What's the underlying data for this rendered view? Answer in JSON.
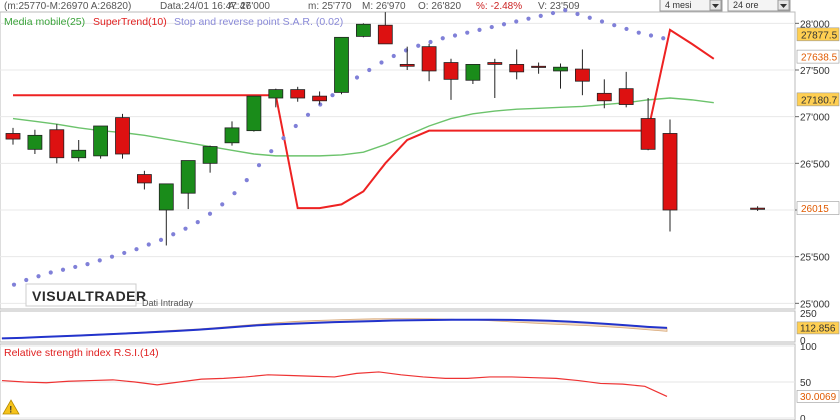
{
  "header": {
    "ohlc_range": "(m:25770-M:26970 A:26820)",
    "date": "Data:24/01 16:47:47",
    "last": "A: 26'000",
    "min": "m: 25'770",
    "max": "M: 26'970",
    "open": "O: 26'820",
    "pct": "%: -2.48%",
    "volume": "V: 23'509",
    "period_select": "4 mesi",
    "timeframe_select": "24 ore"
  },
  "legend": {
    "sma": "Media mobile(25)",
    "supertrend": "SuperTrend(10)",
    "sar": "Stop and reverse point S.A.R. (0.02)",
    "rsi": "Relative strength index R.S.I.(14)"
  },
  "logo": {
    "name": "VISUALTRADER",
    "sub": "Dati Intraday"
  },
  "colors": {
    "up": "#1a8c1a",
    "down": "#dd1111",
    "sma": "#6cc36c",
    "supertrend": "#ee2222",
    "sar": "#8080d8",
    "rsi": "#ee3333",
    "osc": "#2233cc"
  },
  "chart_data": [
    {
      "type": "candlestick",
      "ylim": [
        24950,
        28100
      ],
      "y_ticks": [
        "28'000",
        "27'500",
        "27'000",
        "26'500",
        "26'000",
        "25'500",
        "25'000"
      ],
      "y_tick_values": [
        28000,
        27500,
        27000,
        26500,
        26000,
        25500,
        25000
      ],
      "candles": [
        {
          "o": 26820,
          "h": 26880,
          "l": 26700,
          "c": 26760
        },
        {
          "o": 26650,
          "h": 26860,
          "l": 26600,
          "c": 26800
        },
        {
          "o": 26860,
          "h": 26920,
          "l": 26500,
          "c": 26560
        },
        {
          "o": 26560,
          "h": 26750,
          "l": 26520,
          "c": 26640
        },
        {
          "o": 26580,
          "h": 26900,
          "l": 26550,
          "c": 26900
        },
        {
          "o": 26990,
          "h": 27030,
          "l": 26550,
          "c": 26600
        },
        {
          "o": 26380,
          "h": 26420,
          "l": 26220,
          "c": 26290
        },
        {
          "o": 26000,
          "h": 26270,
          "l": 25620,
          "c": 26280
        },
        {
          "o": 26180,
          "h": 26530,
          "l": 26010,
          "c": 26530
        },
        {
          "o": 26500,
          "h": 26690,
          "l": 26400,
          "c": 26680
        },
        {
          "o": 26720,
          "h": 26950,
          "l": 26690,
          "c": 26880
        },
        {
          "o": 26850,
          "h": 27220,
          "l": 26840,
          "c": 27220
        },
        {
          "o": 27200,
          "h": 27300,
          "l": 27100,
          "c": 27290
        },
        {
          "o": 27290,
          "h": 27320,
          "l": 27160,
          "c": 27200
        },
        {
          "o": 27220,
          "h": 27270,
          "l": 27130,
          "c": 27170
        },
        {
          "o": 27260,
          "h": 27850,
          "l": 27240,
          "c": 27850
        },
        {
          "o": 27860,
          "h": 28000,
          "l": 27850,
          "c": 27990
        },
        {
          "o": 27980,
          "h": 28120,
          "l": 27780,
          "c": 27780
        },
        {
          "o": 27560,
          "h": 27750,
          "l": 27500,
          "c": 27540
        },
        {
          "o": 27750,
          "h": 27780,
          "l": 27380,
          "c": 27490
        },
        {
          "o": 27580,
          "h": 27620,
          "l": 27180,
          "c": 27400
        },
        {
          "o": 27390,
          "h": 27560,
          "l": 27350,
          "c": 27560
        },
        {
          "o": 27580,
          "h": 27620,
          "l": 27200,
          "c": 27560
        },
        {
          "o": 27560,
          "h": 27720,
          "l": 27400,
          "c": 27480
        },
        {
          "o": 27540,
          "h": 27580,
          "l": 27460,
          "c": 27530
        },
        {
          "o": 27490,
          "h": 27570,
          "l": 27300,
          "c": 27530
        },
        {
          "o": 27510,
          "h": 27720,
          "l": 27230,
          "c": 27380
        },
        {
          "o": 27250,
          "h": 27400,
          "l": 27090,
          "c": 27170
        },
        {
          "o": 27300,
          "h": 27480,
          "l": 27100,
          "c": 27130
        },
        {
          "o": 26980,
          "h": 27200,
          "l": 26640,
          "c": 26650
        },
        {
          "o": 26820,
          "h": 26970,
          "l": 25770,
          "c": 26000
        },
        null,
        null,
        null,
        {
          "o": 26020,
          "h": 26040,
          "l": 25990,
          "c": 26010
        }
      ],
      "sma": [
        26980,
        26950,
        26920,
        26880,
        26850,
        26830,
        26800,
        26760,
        26720,
        26680,
        26640,
        26600,
        26580,
        26580,
        26580,
        26590,
        26620,
        26700,
        26800,
        26900,
        26980,
        27030,
        27060,
        27080,
        27090,
        27100,
        27110,
        27130,
        27150,
        27180,
        27200,
        27180,
        27150
      ],
      "supertrend": [
        27230,
        27230,
        27230,
        27230,
        27230,
        27230,
        27230,
        27230,
        27230,
        27230,
        27230,
        27230,
        27230,
        26020,
        26020,
        26060,
        26200,
        26500,
        26750,
        26850,
        26850,
        26850,
        26850,
        26850,
        26850,
        26850,
        26850,
        26850,
        26850,
        26850,
        27930,
        27780,
        27620
      ],
      "sar": [
        25200,
        25250,
        25290,
        25330,
        25360,
        25390,
        25420,
        25460,
        25500,
        25540,
        25580,
        25630,
        25680,
        25740,
        25800,
        25870,
        25960,
        26060,
        26180,
        26320,
        26480,
        26630,
        26770,
        26900,
        27020,
        27130,
        27230,
        27330,
        27420,
        27500,
        27580,
        27650,
        27710,
        27760,
        27800,
        27840,
        27870,
        27900,
        27930,
        27960,
        27990,
        28020,
        28050,
        28080,
        28110,
        28140,
        28100,
        28060,
        28020,
        27980,
        27940,
        27900,
        27870,
        27840
      ],
      "labels": [
        {
          "value": "27877.5",
          "y": 27877,
          "bg": "#ffcf52"
        },
        {
          "value": "27638.5",
          "y": 27638,
          "bg": "#ffffff"
        },
        {
          "value": "27180.7",
          "y": 27180,
          "bg": "#ffcf52"
        },
        {
          "value": "26015",
          "y": 26015,
          "bg": "#ffffff"
        }
      ]
    },
    {
      "type": "oscillator",
      "ylim": [
        0,
        250
      ],
      "y_ticks": [
        "250",
        "0"
      ],
      "label": "112.856",
      "values": [
        15,
        20,
        28,
        35,
        42,
        50,
        58,
        66,
        75,
        85,
        95,
        108,
        122,
        135,
        145,
        152,
        158,
        165,
        170,
        175,
        180,
        183,
        185,
        187,
        188,
        188,
        186,
        183,
        178,
        170,
        160,
        148,
        135,
        122,
        112
      ],
      "band": [
        18,
        22,
        30,
        38,
        46,
        54,
        62,
        72,
        82,
        92,
        102,
        115,
        130,
        145,
        160,
        172,
        180,
        186,
        192,
        196,
        198,
        198,
        196,
        192,
        186,
        178,
        168,
        158,
        148,
        140,
        132,
        122,
        110,
        95,
        80
      ]
    },
    {
      "type": "line",
      "name": "R.S.I.",
      "ylim": [
        0,
        100
      ],
      "y_ticks": [
        "100",
        "50",
        "0"
      ],
      "label": "30.0069",
      "values": [
        52,
        50,
        49,
        51,
        52,
        53,
        50,
        46,
        50,
        54,
        55,
        57,
        60,
        59,
        58,
        57,
        62,
        64,
        60,
        57,
        55,
        55,
        57,
        57,
        56,
        55,
        52,
        48,
        47,
        44,
        30
      ]
    }
  ]
}
